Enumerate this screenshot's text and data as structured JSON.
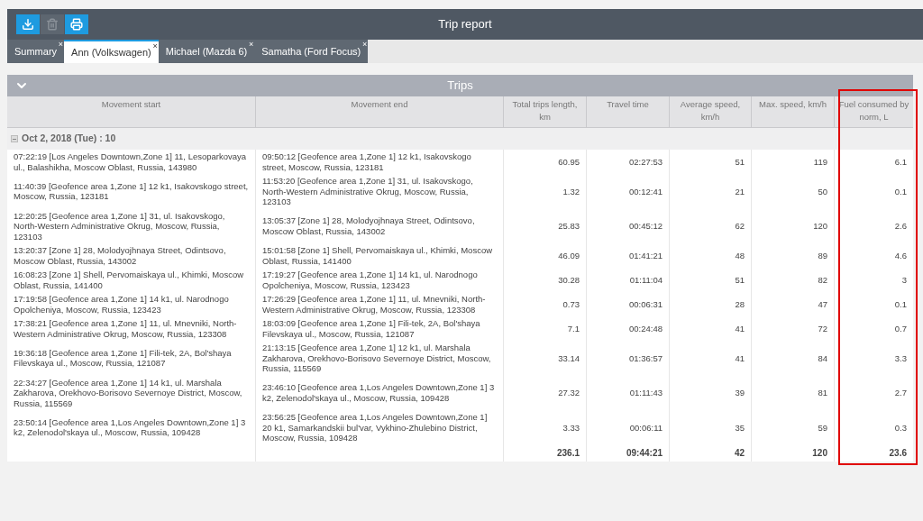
{
  "window": {
    "title": "Trip report"
  },
  "toolbar": [
    {
      "kind": "download",
      "disabled": false
    },
    {
      "kind": "delete",
      "disabled": true
    },
    {
      "kind": "print",
      "disabled": false
    }
  ],
  "tabs": [
    {
      "label": "Summary",
      "close": "×",
      "selected": false
    },
    {
      "label": "Ann (Volkswagen)",
      "close": "×",
      "selected": true
    },
    {
      "label": "Michael (Mazda 6)",
      "close": "×",
      "selected": false
    },
    {
      "label": "Samatha (Ford Focus)",
      "close": "×",
      "selected": false
    }
  ],
  "panel": {
    "title": "Trips",
    "expanded": true
  },
  "table": {
    "columns": [
      {
        "label": "Movement start",
        "highlighted": false
      },
      {
        "label": "Movement end",
        "highlighted": false
      },
      {
        "label": "Total trips length, km",
        "highlighted": false
      },
      {
        "label": "Travel time",
        "highlighted": false
      },
      {
        "label": "Average speed, km/h",
        "highlighted": false
      },
      {
        "label": "Max. speed, km/h",
        "highlighted": false
      },
      {
        "label": "Fuel consumed by norm, L",
        "highlighted": true
      }
    ],
    "group": {
      "label": "Oct 2, 2018 (Tue) : 10",
      "expanded": true
    },
    "rows": [
      [
        "07:22:19 [Los Angeles Downtown,Zone 1] 11, Lesoparkovaya ul., Balashikha, Moscow Oblast, Russia, 143980",
        "09:50:12 [Geofence area 1,Zone 1] 12 k1, Isakovskogo street, Moscow, Russia, 123181",
        "60.95",
        "02:27:53",
        "51",
        "119",
        "6.1"
      ],
      [
        "11:40:39 [Geofence area 1,Zone 1] 12 k1, Isakovskogo street, Moscow, Russia, 123181",
        "11:53:20 [Geofence area 1,Zone 1] 31, ul. Isakovskogo, North-Western Administrative Okrug, Moscow, Russia, 123103",
        "1.32",
        "00:12:41",
        "21",
        "50",
        "0.1"
      ],
      [
        "12:20:25 [Geofence area 1,Zone 1] 31, ul. Isakovskogo, North-Western Administrative Okrug, Moscow, Russia, 123103",
        "13:05:37 [Zone 1] 28, Molodyojhnaya Street, Odintsovo, Moscow Oblast, Russia, 143002",
        "25.83",
        "00:45:12",
        "62",
        "120",
        "2.6"
      ],
      [
        "13:20:37 [Zone 1] 28, Molodyojhnaya Street, Odintsovo, Moscow Oblast, Russia, 143002",
        "15:01:58 [Zone 1] Shell, Pervomaiskaya ul., Khimki, Moscow Oblast, Russia, 141400",
        "46.09",
        "01:41:21",
        "48",
        "89",
        "4.6"
      ],
      [
        "16:08:23 [Zone 1] Shell, Pervomaiskaya ul., Khimki, Moscow Oblast, Russia, 141400",
        "17:19:27 [Geofence area 1,Zone 1] 14 k1, ul. Narodnogo Opolcheniya, Moscow, Russia, 123423",
        "30.28",
        "01:11:04",
        "51",
        "82",
        "3"
      ],
      [
        "17:19:58 [Geofence area 1,Zone 1] 14 k1, ul. Narodnogo Opolcheniya, Moscow, Russia, 123423",
        "17:26:29 [Geofence area 1,Zone 1] 11, ul. Mnevniki, North-Western Administrative Okrug, Moscow, Russia, 123308",
        "0.73",
        "00:06:31",
        "28",
        "47",
        "0.1"
      ],
      [
        "17:38:21 [Geofence area 1,Zone 1] 11, ul. Mnevniki, North-Western Administrative Okrug, Moscow, Russia, 123308",
        "18:03:09 [Geofence area 1,Zone 1] Fili-tek, 2A, Bol'shaya Filevskaya ul., Moscow, Russia, 121087",
        "7.1",
        "00:24:48",
        "41",
        "72",
        "0.7"
      ],
      [
        "19:36:18 [Geofence area 1,Zone 1] Fili-tek, 2A, Bol'shaya Filevskaya ul., Moscow, Russia, 121087",
        "21:13:15 [Geofence area 1,Zone 1] 12 k1, ul. Marshala Zakharova, Orekhovo-Borisovo Severnoye District, Moscow, Russia, 115569",
        "33.14",
        "01:36:57",
        "41",
        "84",
        "3.3"
      ],
      [
        "22:34:27 [Geofence area 1,Zone 1] 14 k1, ul. Marshala Zakharova, Orekhovo-Borisovo Severnoye District, Moscow, Russia, 115569",
        "23:46:10 [Geofence area 1,Los Angeles Downtown,Zone 1] 3 k2, Zelenodol'skaya ul., Moscow, Russia, 109428",
        "27.32",
        "01:11:43",
        "39",
        "81",
        "2.7"
      ],
      [
        "23:50:14 [Geofence area 1,Los Angeles Downtown,Zone 1] 3 k2, Zelenodol'skaya ul., Moscow, Russia, 109428",
        "23:56:25 [Geofence area 1,Los Angeles Downtown,Zone 1] 20 k1, Samarkandskii bul'var, Vykhino-Zhulebino District, Moscow, Russia, 109428",
        "3.33",
        "00:06:11",
        "35",
        "59",
        "0.3"
      ]
    ],
    "totals": [
      "236.1",
      "09:44:21",
      "42",
      "120",
      "23.6"
    ]
  }
}
